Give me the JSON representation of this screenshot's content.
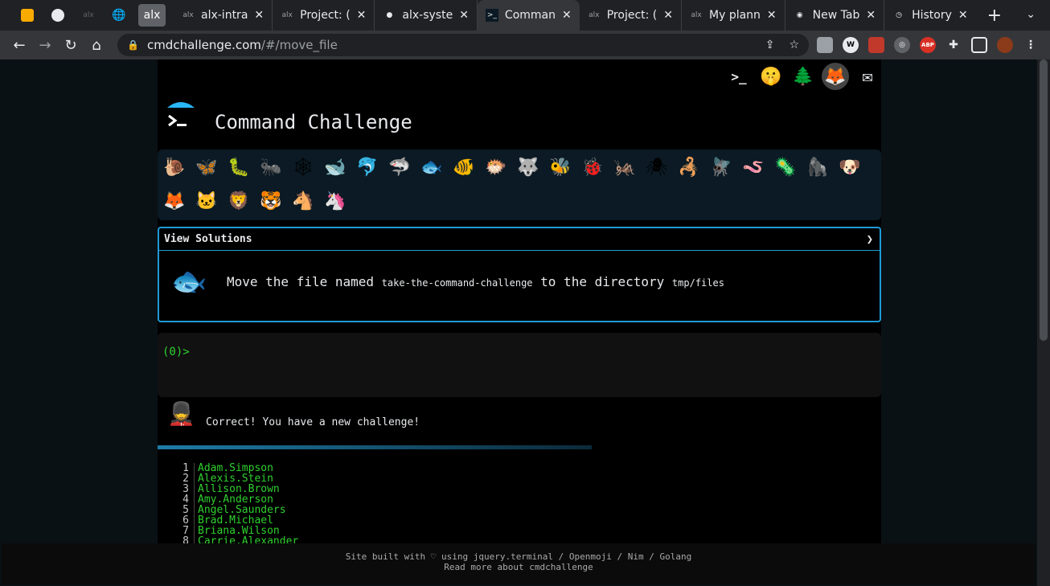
{
  "tabs": [
    {
      "label": "alx-intra",
      "favicon": "alx-icon"
    },
    {
      "label": "Project: (",
      "favicon": "alx-icon"
    },
    {
      "label": "alx-syste",
      "favicon": "github-icon"
    },
    {
      "label": "Comman",
      "favicon": "terminal-icon",
      "active": true
    },
    {
      "label": "Project: (",
      "favicon": "alx-icon"
    },
    {
      "label": "My plann",
      "favicon": "alx-icon"
    },
    {
      "label": "New Tab",
      "favicon": "chrome-icon"
    },
    {
      "label": "History",
      "favicon": "history-icon"
    }
  ],
  "pinned_tab": {
    "label": "alx"
  },
  "address": {
    "host": "cmdchallenge.com",
    "path": "/#/move_file"
  },
  "page": {
    "title": "Command Challenge",
    "view_solutions": "View Solutions",
    "task_prefix": "Move the file named",
    "task_file": "take-the-command-challenge",
    "task_mid": "to the directory",
    "task_dir": "tmp/files",
    "prompt": "(0)>",
    "correct_msg": "Correct! You have a new challenge!"
  },
  "names": [
    {
      "n": "1",
      "name": "Adam.Simpson"
    },
    {
      "n": "2",
      "name": "Alexis.Stein"
    },
    {
      "n": "3",
      "name": "Allison.Brown"
    },
    {
      "n": "4",
      "name": "Amy.Anderson"
    },
    {
      "n": "5",
      "name": "Angel.Saunders"
    },
    {
      "n": "6",
      "name": "Brad.Michael"
    },
    {
      "n": "7",
      "name": "Briana.Wilson"
    },
    {
      "n": "8",
      "name": "Carrie.Alexander"
    }
  ],
  "footer": {
    "line1": "Site built with ♡ using jquery.terminal / Openmoji / Nim / Golang",
    "line2": "Read more about cmdchallenge"
  }
}
